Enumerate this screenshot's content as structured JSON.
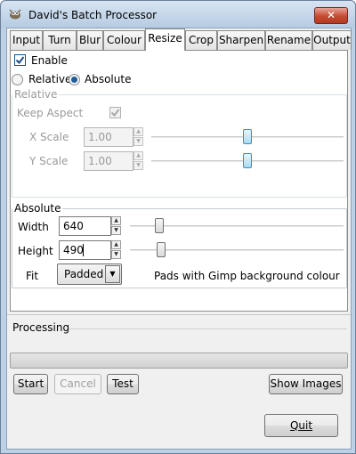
{
  "window": {
    "title": "David's Batch Processor",
    "close_glyph": "✕"
  },
  "tabs": [
    {
      "label": "Input"
    },
    {
      "label": "Turn"
    },
    {
      "label": "Blur"
    },
    {
      "label": "Colour"
    },
    {
      "label": "Resize"
    },
    {
      "label": "Crop"
    },
    {
      "label": "Sharpen"
    },
    {
      "label": "Rename"
    },
    {
      "label": "Output"
    }
  ],
  "active_tab": "Resize",
  "resize": {
    "enable_label": "Enable",
    "enable_checked": true,
    "mode_relative_label": "Relative",
    "mode_absolute_label": "Absolute",
    "selected_mode": "Absolute",
    "relative": {
      "group_title": "Relative",
      "keep_aspect_label": "Keep Aspect",
      "keep_aspect_checked": true,
      "x_scale_label": "X Scale",
      "x_scale_value": "1.00",
      "y_scale_label": "Y Scale",
      "y_scale_value": "1.00",
      "x_slider_level": 0.5,
      "y_slider_level": 0.5
    },
    "absolute": {
      "group_title": "Absolute",
      "width_label": "Width",
      "width_value": "640",
      "height_label": "Height",
      "height_value": "490",
      "width_slider_level": 0.12,
      "height_slider_level": 0.13,
      "fit_label": "Fit",
      "fit_value": "Padded",
      "fit_note": "Pads with Gimp background colour"
    }
  },
  "processing": {
    "group_title": "Processing",
    "progress": 0,
    "start_label": "Start",
    "cancel_label": "Cancel",
    "test_label": "Test",
    "show_images_label": "Show Images"
  },
  "quit_label": "Quit",
  "icons": {
    "app": "gimp-wilber-icon",
    "check": "checkmark-icon",
    "spin_up": "spin-up-arrow-icon",
    "spin_down": "spin-down-arrow-icon",
    "dropdown": "dropdown-arrow-icon"
  },
  "colors": {
    "titlebar": "#c9dbee",
    "close_button": "#c44a32",
    "selection": "#1f5d99"
  }
}
